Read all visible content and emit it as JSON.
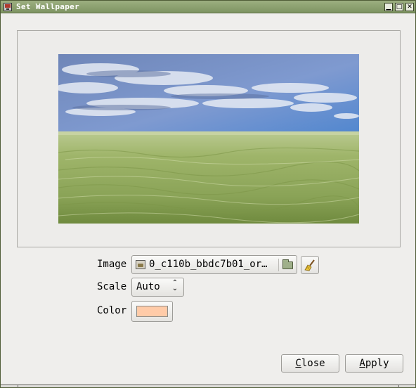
{
  "window": {
    "title": "Set Wallpaper",
    "controls": {
      "minimize": "▁",
      "maximize": "□",
      "close": "✕"
    }
  },
  "form": {
    "image_label": "Image",
    "image_filename": "0_c110b_bbdc7b01_or…",
    "scale_label": "Scale",
    "scale_value": "Auto",
    "color_label": "Color",
    "color_value": "#ffcba8"
  },
  "buttons": {
    "close_mnemonic": "C",
    "close_rest": "lose",
    "apply_mnemonic": "A",
    "apply_rest": "pply"
  },
  "icons": {
    "app": "wallpaper-app-icon",
    "file": "image-file-icon",
    "folder": "open-folder-icon",
    "clear": "broom-clear-icon",
    "scale_arrows": "up-down-arrows-icon"
  },
  "colors": {
    "titlebar": "#8ea371",
    "window_bg": "#efeeec"
  }
}
